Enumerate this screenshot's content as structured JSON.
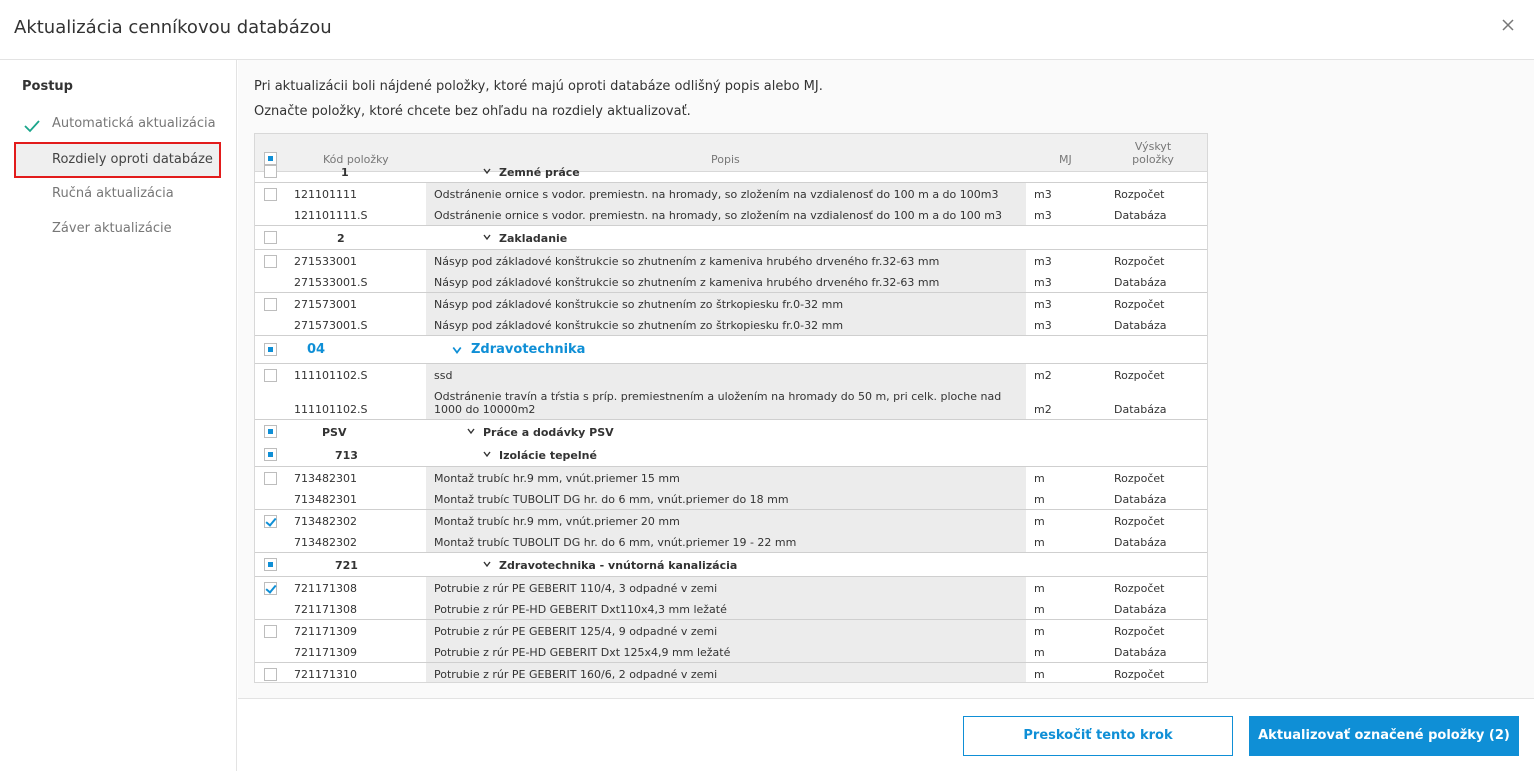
{
  "dialog": {
    "title": "Aktualizácia cenníkovou databázou"
  },
  "sidebar": {
    "heading": "Postup",
    "steps": [
      {
        "label": "Automatická aktualizácia",
        "state": "done"
      },
      {
        "label": "Rozdiely oproti databáze",
        "state": "active"
      },
      {
        "label": "Ručná aktualizácia",
        "state": "pending"
      },
      {
        "label": "Záver aktualizácie",
        "state": "pending"
      }
    ]
  },
  "main": {
    "info_line1": "Pri aktualizácii boli nájdené položky, ktoré majú oproti databáze odlišný popis alebo MJ.",
    "info_line2": "Označte položky, ktoré chcete bez ohľadu na rozdiely aktualizovať."
  },
  "table": {
    "headers": {
      "code": "Kód položky",
      "description": "Popis",
      "unit": "MJ",
      "occurrence": "Výskyt položky"
    },
    "partial_group": {
      "code": "1",
      "name": "Zemné práce"
    },
    "rows": [
      {
        "pair": [
          {
            "code": "121101111",
            "desc": "Odstránenie ornice s vodor. premiestn. na hromady, so zložením na vzdialenosť do 100 m a do 100m3",
            "unit": "m3",
            "source": "Rozpočet"
          },
          {
            "code": "121101111.S",
            "desc": "Odstránenie ornice s vodor. premiestn. na hromady, so zložením na vzdialenosť do 100 m a do 100 m3",
            "unit": "m3",
            "source": "Databáza"
          }
        ]
      },
      {
        "group": {
          "code": "2",
          "name": "Zakladanie"
        }
      },
      {
        "pair": [
          {
            "code": "271533001",
            "desc": "Násyp pod základové konštrukcie so zhutnením z kameniva hrubého drveného fr.32-63 mm",
            "unit": "m3",
            "source": "Rozpočet"
          },
          {
            "code": "271533001.S",
            "desc": "Násyp pod základové konštrukcie so zhutnením z kameniva hrubého drveného fr.32-63 mm",
            "unit": "m3",
            "source": "Databáza"
          }
        ]
      },
      {
        "pair": [
          {
            "code": "271573001",
            "desc": "Násyp pod základové konštrukcie so zhutnením zo štrkopiesku fr.0-32 mm",
            "unit": "m3",
            "source": "Rozpočet"
          },
          {
            "code": "271573001.S",
            "desc": "Násyp pod základové konštrukcie so zhutnením zo štrkopiesku fr.0-32 mm",
            "unit": "m3",
            "source": "Databáza"
          }
        ]
      },
      {
        "section": {
          "code": "04",
          "name": "Zdravotechnika"
        }
      },
      {
        "pair": [
          {
            "code": "111101102.S",
            "desc": "ssd",
            "unit": "m2",
            "source": "Rozpočet"
          },
          {
            "code": "111101102.S",
            "desc": "Odstránenie travín a tŕstia s príp. premiestnením a uložením na hromady do 50 m, pri celk. ploche nad 1000 do 10000m2",
            "unit": "m2",
            "source": "Databáza"
          }
        ]
      },
      {
        "group": {
          "code": "PSV",
          "name": "Práce a dodávky PSV"
        }
      },
      {
        "group": {
          "code": "713",
          "name": "Izolácie tepelné"
        }
      },
      {
        "pair": [
          {
            "code": "713482301",
            "desc": "Montaž trubíc hr.9 mm, vnút.priemer 15 mm",
            "unit": "m",
            "source": "Rozpočet"
          },
          {
            "code": "713482301",
            "desc": "Montaž trubíc TUBOLIT DG hr. do 6 mm, vnút.priemer do 18 mm",
            "unit": "m",
            "source": "Databáza"
          }
        ]
      },
      {
        "pair": [
          {
            "code": "713482302",
            "desc": "Montaž trubíc hr.9 mm, vnút.priemer 20 mm",
            "unit": "m",
            "source": "Rozpočet"
          },
          {
            "code": "713482302",
            "desc": "Montaž trubíc TUBOLIT DG hr. do 6 mm, vnút.priemer 19 - 22 mm",
            "unit": "m",
            "source": "Databáza"
          }
        ]
      },
      {
        "group": {
          "code": "721",
          "name": "Zdravotechnika - vnútorná kanalizácia"
        }
      },
      {
        "pair": [
          {
            "code": "721171308",
            "desc": "Potrubie z rúr PE GEBERIT 110/4, 3 odpadné v zemi",
            "unit": "m",
            "source": "Rozpočet"
          },
          {
            "code": "721171308",
            "desc": "Potrubie z rúr PE-HD GEBERIT Dxt110x4,3 mm ležaté",
            "unit": "m",
            "source": "Databáza"
          }
        ]
      },
      {
        "pair": [
          {
            "code": "721171309",
            "desc": "Potrubie z rúr PE GEBERIT 125/4, 9 odpadné v zemi",
            "unit": "m",
            "source": "Rozpočet"
          },
          {
            "code": "721171309",
            "desc": "Potrubie z rúr PE-HD GEBERIT Dxt 125x4,9 mm ležaté",
            "unit": "m",
            "source": "Databáza"
          }
        ]
      },
      {
        "single": {
          "code": "721171310",
          "desc": "Potrubie z rúr PE GEBERIT 160/6, 2 odpadné v zemi",
          "unit": "m",
          "source": "Rozpočet"
        }
      }
    ]
  },
  "footer": {
    "skip_label": "Preskočiť tento krok",
    "update_label": "Aktualizovať označené položky (2)"
  },
  "colors": {
    "accent": "#0f8fd6",
    "highlight_border": "#e21b1b",
    "check_green": "#1aa58b"
  }
}
